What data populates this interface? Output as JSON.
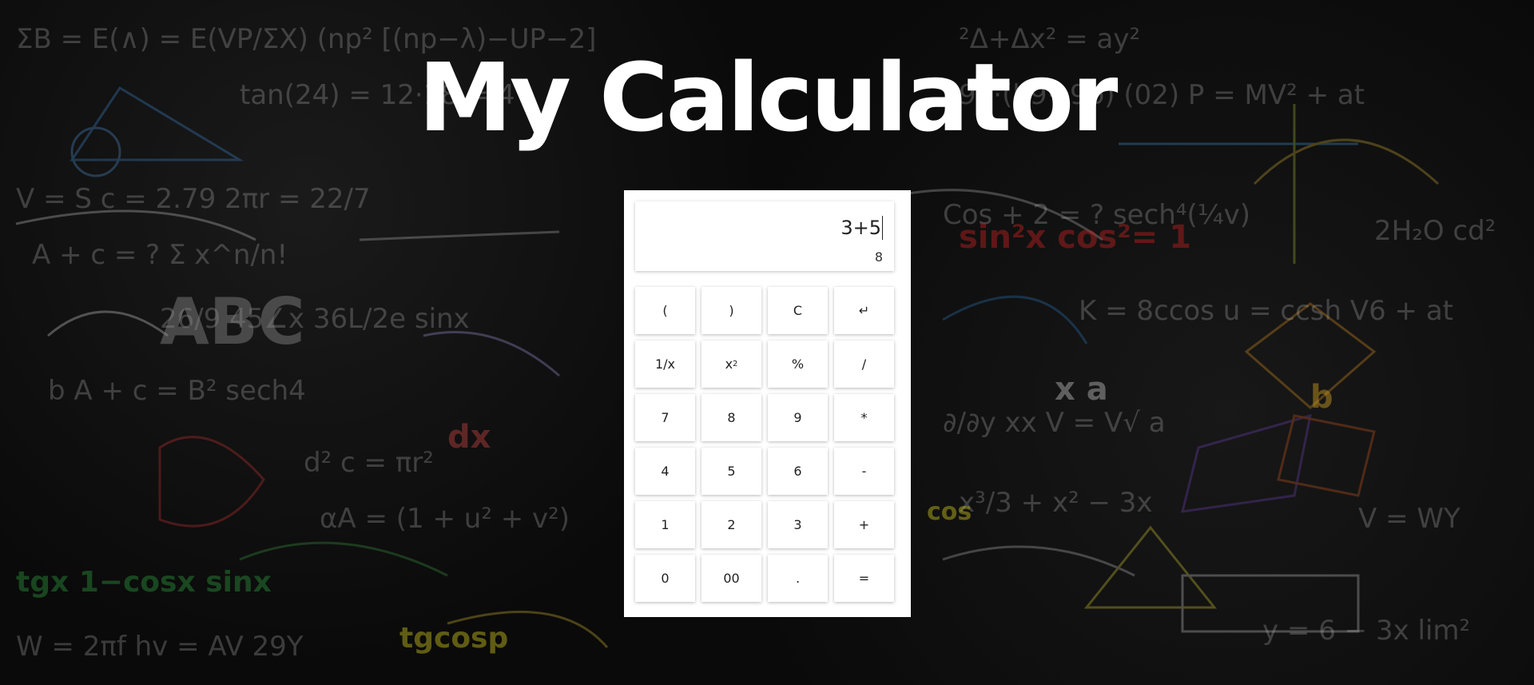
{
  "page": {
    "title": "My Calculator"
  },
  "display": {
    "expression": "3+5",
    "result": "8"
  },
  "keys": [
    {
      "name": "open-paren-key",
      "label": "("
    },
    {
      "name": "close-paren-key",
      "label": ")"
    },
    {
      "name": "clear-key",
      "label": "C"
    },
    {
      "name": "backspace-key",
      "label": "↵"
    },
    {
      "name": "reciprocal-key",
      "label": "1/x"
    },
    {
      "name": "square-key",
      "label": "x",
      "sup": "2"
    },
    {
      "name": "percent-key",
      "label": "%"
    },
    {
      "name": "divide-key",
      "label": "/"
    },
    {
      "name": "seven-key",
      "label": "7"
    },
    {
      "name": "eight-key",
      "label": "8"
    },
    {
      "name": "nine-key",
      "label": "9"
    },
    {
      "name": "multiply-key",
      "label": "*"
    },
    {
      "name": "four-key",
      "label": "4"
    },
    {
      "name": "five-key",
      "label": "5"
    },
    {
      "name": "six-key",
      "label": "6"
    },
    {
      "name": "subtract-key",
      "label": "-"
    },
    {
      "name": "one-key",
      "label": "1"
    },
    {
      "name": "two-key",
      "label": "2"
    },
    {
      "name": "three-key",
      "label": "3"
    },
    {
      "name": "add-key",
      "label": "+"
    },
    {
      "name": "zero-key",
      "label": "0"
    },
    {
      "name": "double-zero-key",
      "label": "00"
    },
    {
      "name": "decimal-key",
      "label": "."
    },
    {
      "name": "equals-key",
      "label": "="
    }
  ],
  "colors": {
    "background": "#0a0a0a",
    "title": "#ffffff",
    "calculator": "#ffffff"
  }
}
